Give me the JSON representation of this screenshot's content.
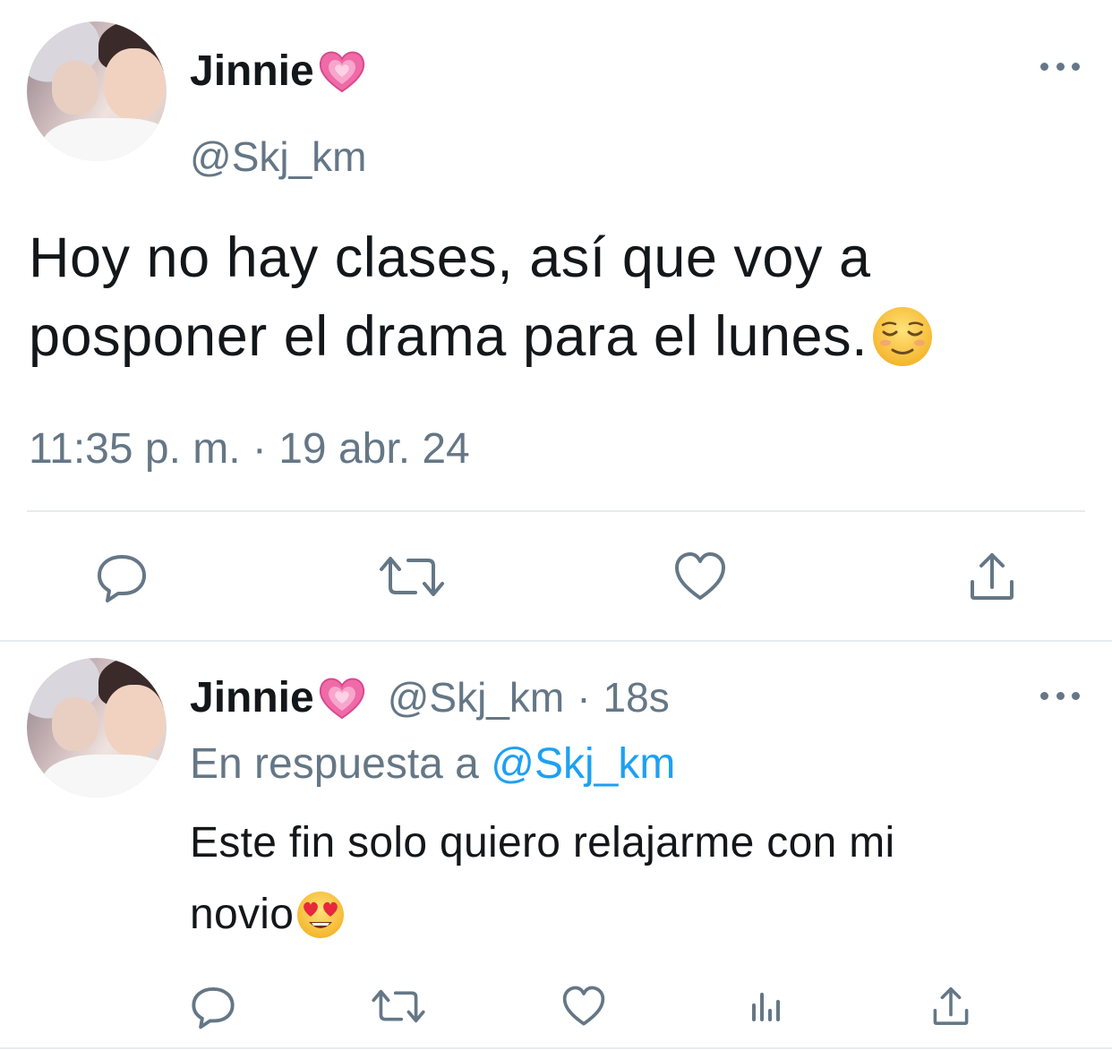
{
  "main_tweet": {
    "display_name": "Jinnie",
    "name_emoji": "sparkling-heart-icon",
    "handle": "@Skj_km",
    "text_line1": "Hoy no hay clases, así que voy a",
    "text_line2": "posponer el drama para el lunes.",
    "text_emoji": "relieved-face-icon",
    "timestamp": "11:35 p. m. · 19 abr. 24"
  },
  "reply_tweet": {
    "display_name": "Jinnie",
    "name_emoji": "sparkling-heart-icon",
    "handle": "@Skj_km",
    "separator": "·",
    "age": "18s",
    "replying_prefix": "En respuesta a",
    "replying_to": "@Skj_km",
    "text_line1": "Este fin solo quiero relajarme con mi",
    "text_line2": "novio",
    "text_emoji": "heart-eyes-face-icon"
  },
  "actions_main": [
    "reply-icon",
    "retweet-icon",
    "like-icon",
    "share-icon"
  ],
  "actions_reply": [
    "reply-icon",
    "retweet-icon",
    "like-icon",
    "analytics-icon",
    "share-icon"
  ],
  "colors": {
    "text": "#14171a",
    "muted": "#657786",
    "link": "#1da1f2",
    "divider": "#e6ecf0",
    "heart_pink": "#f06aa8"
  }
}
